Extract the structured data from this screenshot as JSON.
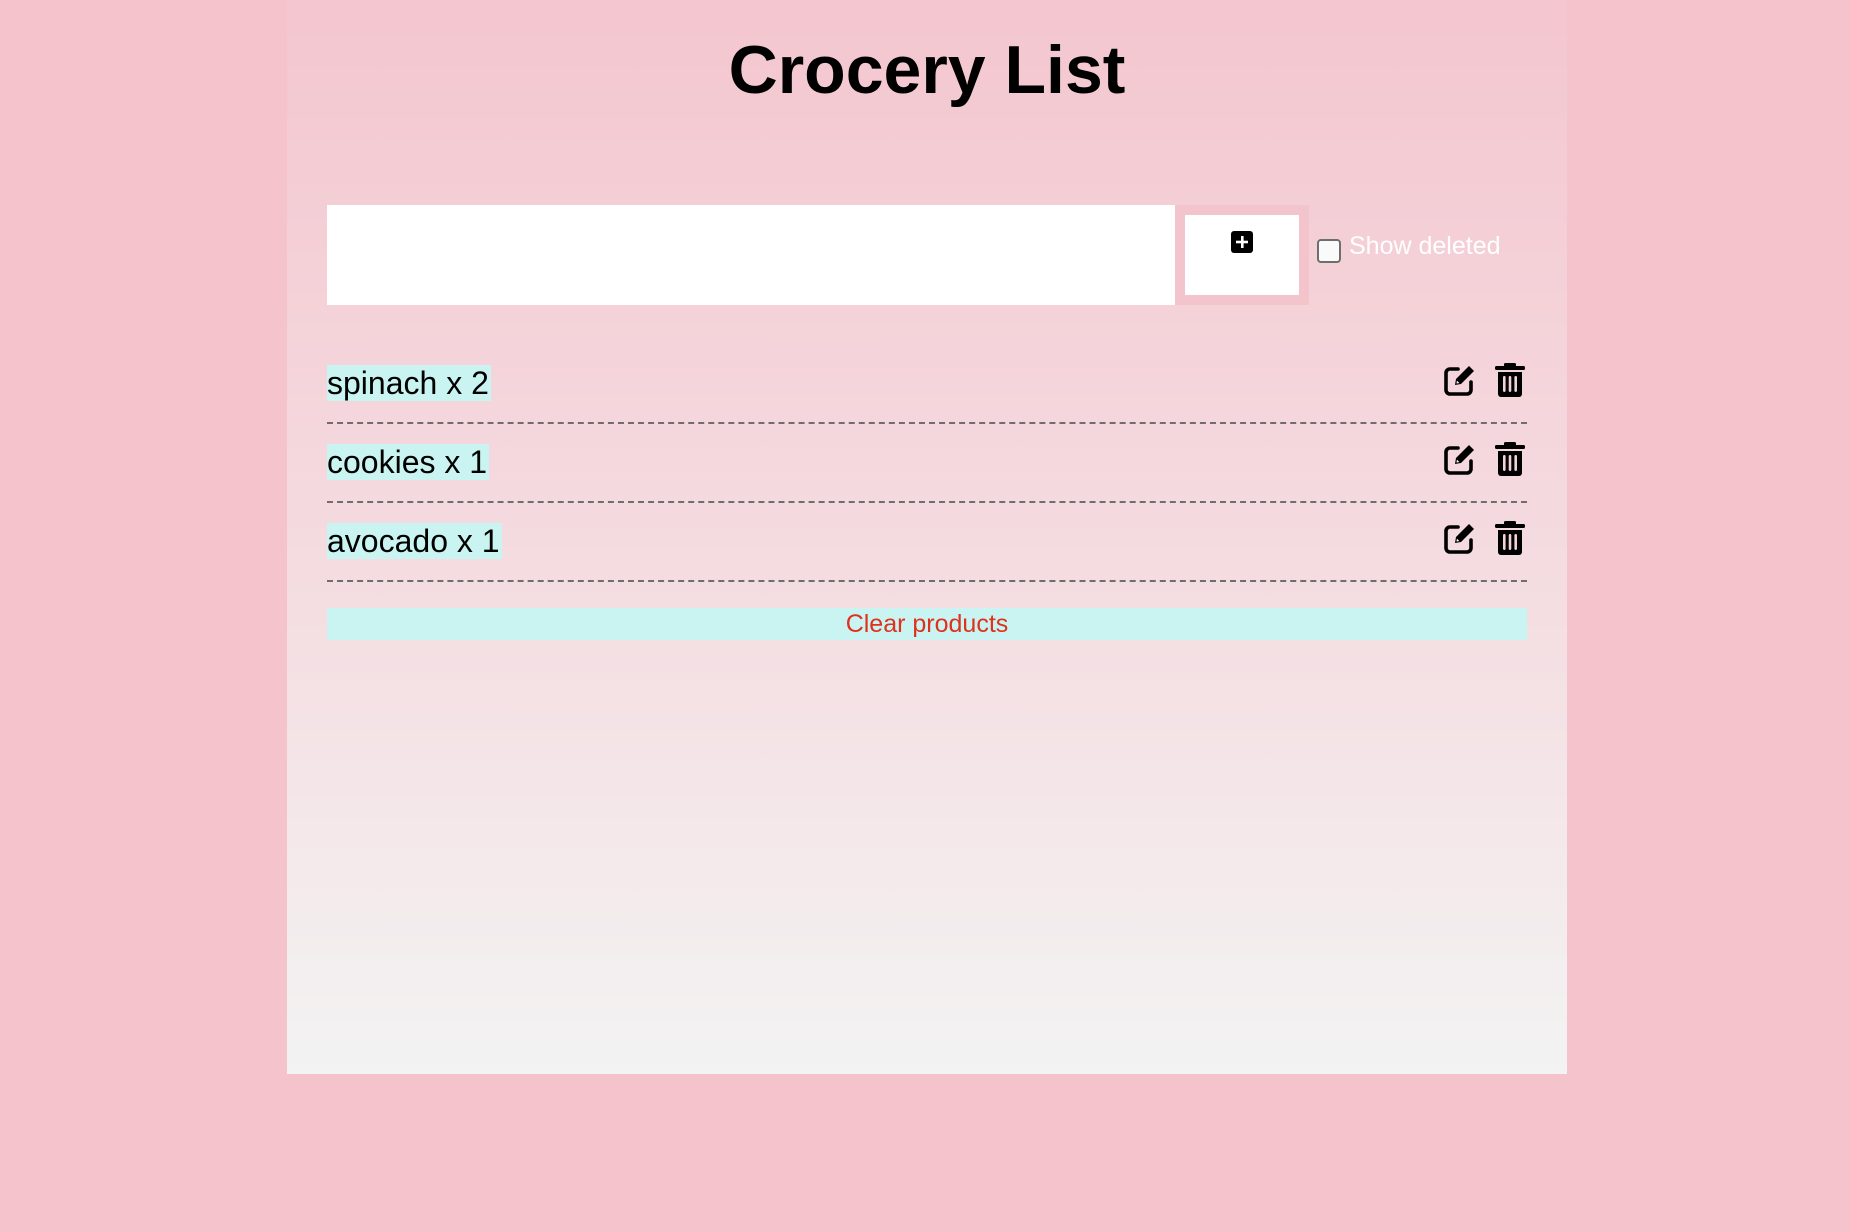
{
  "app": {
    "title": "Crocery List"
  },
  "add_form": {
    "input_value": "",
    "input_placeholder": "",
    "add_icon": "plus-square-icon",
    "show_deleted_label": "Show deleted",
    "show_deleted_checked": false
  },
  "items": [
    {
      "text": "spinach x 2",
      "edit_icon": "edit-icon",
      "delete_icon": "trash-icon"
    },
    {
      "text": "cookies x 1",
      "edit_icon": "edit-icon",
      "delete_icon": "trash-icon"
    },
    {
      "text": "avocado x 1",
      "edit_icon": "edit-icon",
      "delete_icon": "trash-icon"
    }
  ],
  "actions": {
    "clear_label": "Clear products"
  },
  "colors": {
    "page_background": "#f4c3cc",
    "item_highlight": "#c9f4f1",
    "clear_text": "#e0301e",
    "label_text": "#ffffff"
  }
}
